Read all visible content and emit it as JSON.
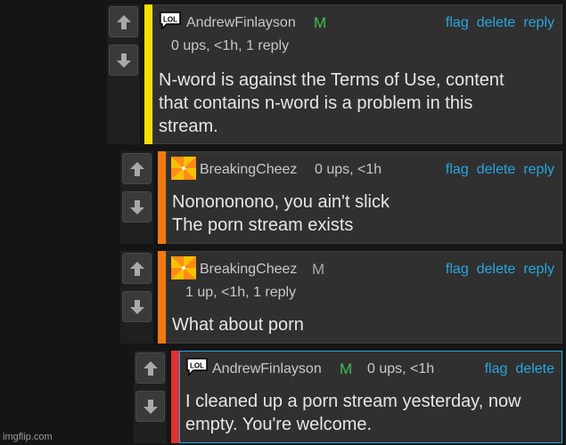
{
  "comments": [
    {
      "author": "AndrewFinlayson",
      "mod_badge": "M",
      "meta": "0 ups, <1h, 1 reply",
      "actions": [
        "flag",
        "delete",
        "reply"
      ],
      "text_lines": [
        "N-word is against the Terms of Use, content",
        "that contains n-word is a problem in this",
        "stream."
      ],
      "bar_color": "#f3e000",
      "mod_color": "#3fbf4f"
    },
    {
      "author": "BreakingCheez",
      "mod_badge": "",
      "meta": "0 ups, <1h",
      "actions": [
        "flag",
        "delete",
        "reply"
      ],
      "text_lines": [
        "Nonononono, you ain't slick",
        "The porn stream exists"
      ],
      "bar_color": "#f07a10"
    },
    {
      "author": "BreakingCheez",
      "mod_badge": "M",
      "meta": "1 up, <1h, 1 reply",
      "actions": [
        "flag",
        "delete",
        "reply"
      ],
      "text_lines": [
        "What about porn"
      ],
      "bar_color": "#f07a10",
      "mod_color": "#a8a8a8"
    },
    {
      "author": "AndrewFinlayson",
      "mod_badge": "M",
      "meta": "0 ups, <1h",
      "actions": [
        "flag",
        "delete"
      ],
      "text_lines": [
        "I cleaned up a porn stream yesterday, now",
        "empty. You're welcome."
      ],
      "bar_color": "#e03030",
      "mod_color": "#3fbf4f"
    }
  ],
  "icons": {
    "avatar_lol": "lol-speech-icon",
    "avatar_pinwheel": "pinwheel-icon",
    "upvote": "upvote-arrow-icon",
    "downvote": "downvote-arrow-icon"
  },
  "accent": "#27a6e0",
  "watermark": "imgflip.com"
}
